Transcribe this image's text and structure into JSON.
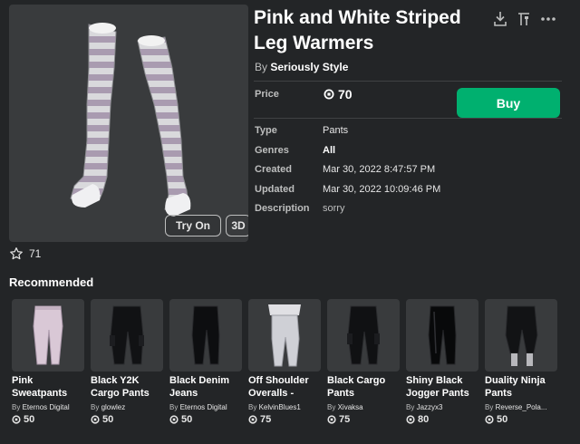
{
  "item": {
    "title": "Pink and White Striped Leg Warmers",
    "by_prefix": "By",
    "creator": "Seriously Style",
    "price_label": "Price",
    "price": "70",
    "buy_label": "Buy",
    "try_on_label": "Try On",
    "three_d_label": "3D",
    "favorites": "71"
  },
  "details": [
    {
      "key": "Type",
      "value": "Pants"
    },
    {
      "key": "Genres",
      "value": "All"
    },
    {
      "key": "Created",
      "value": "Mar 30, 2022 8:47:57 PM"
    },
    {
      "key": "Updated",
      "value": "Mar 30, 2022 10:09:46 PM"
    },
    {
      "key": "Description",
      "value": "sorry"
    }
  ],
  "recommended": {
    "title": "Recommended",
    "items": [
      {
        "name": "Pink Sweatpants",
        "by": "By",
        "creator": "Eternos Digital",
        "price": "50"
      },
      {
        "name": "Black Y2K Cargo Pants",
        "by": "By",
        "creator": "glowlez",
        "price": "50"
      },
      {
        "name": "Black Denim Jeans",
        "by": "By",
        "creator": "Eternos Digital",
        "price": "50"
      },
      {
        "name": "Off Shoulder Overalls -",
        "by": "By",
        "creator": "KelvinBlues1",
        "price": "75"
      },
      {
        "name": "Black Cargo Pants",
        "by": "By",
        "creator": "Xivaksa",
        "price": "75"
      },
      {
        "name": "Shiny Black Jogger Pants",
        "by": "By",
        "creator": "Jazzyx3",
        "price": "80"
      },
      {
        "name": "Duality Ninja Pants",
        "by": "By",
        "creator": "Reverse_Pola...",
        "price": "50"
      }
    ]
  },
  "colors": {
    "background": "#232527",
    "buy": "#00b06f",
    "panel": "#393b3d"
  },
  "icons": [
    "download-icon",
    "configure-icon",
    "more-icon",
    "star-icon",
    "robux-icon"
  ]
}
